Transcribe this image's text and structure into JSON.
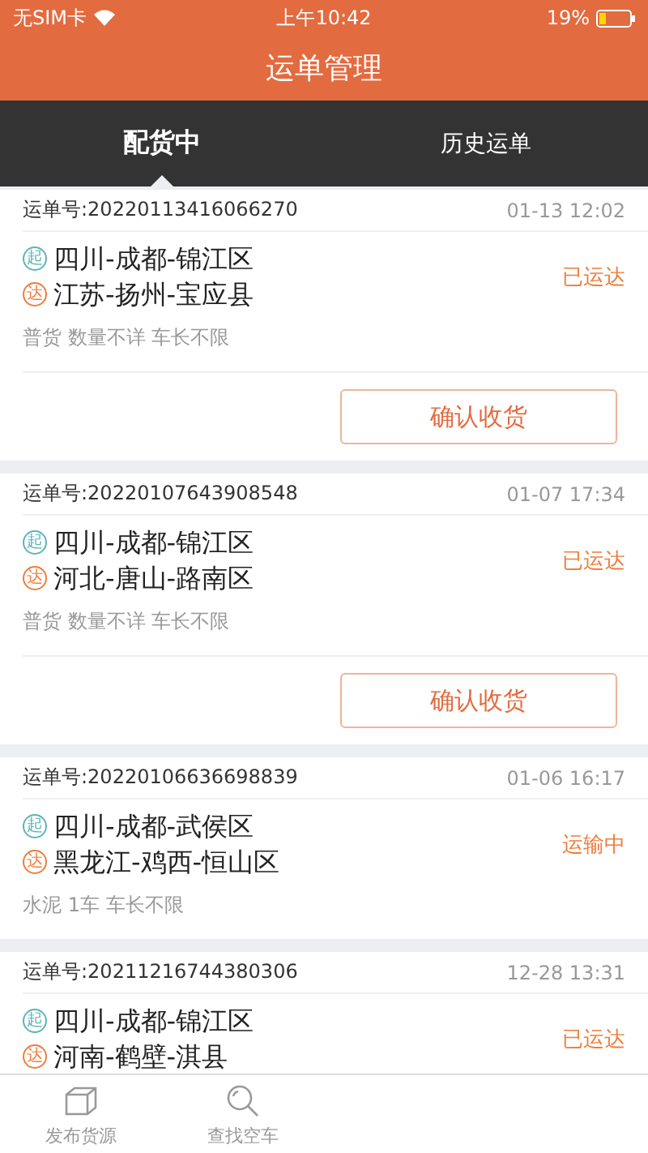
{
  "status_bar": {
    "carrier": "无SIM卡",
    "time": "上午10:42",
    "battery": "19%"
  },
  "header": {
    "title": "运单管理"
  },
  "tabs": [
    {
      "label": "配货中",
      "selected": true
    },
    {
      "label": "历史运单",
      "selected": false
    }
  ],
  "orders": [
    {
      "number": "运单号:20220113416066270",
      "time": "01-13 12:02",
      "from_mark": "起",
      "from": "四川-成都-锦江区",
      "to_mark": "达",
      "to": "江苏-扬州-宝应县",
      "status": "已运达",
      "details": "普货 数量不详 车长不限",
      "action": "确认收货"
    },
    {
      "number": "运单号:20220107643908548",
      "time": "01-07 17:34",
      "from_mark": "起",
      "from": "四川-成都-锦江区",
      "to_mark": "达",
      "to": "河北-唐山-路南区",
      "status": "已运达",
      "details": "普货 数量不详 车长不限",
      "action": "确认收货"
    },
    {
      "number": "运单号:20220106636698839",
      "time": "01-06 16:17",
      "from_mark": "起",
      "from": "四川-成都-武侯区",
      "to_mark": "达",
      "to": "黑龙江-鸡西-恒山区",
      "status": "运输中",
      "details": "水泥 1车 车长不限"
    },
    {
      "number": "运单号:20211216744380306",
      "time": "12-28 13:31",
      "from_mark": "起",
      "from": "四川-成都-锦江区",
      "to_mark": "达",
      "to": "河南-鹤壁-淇县",
      "status": "已运达"
    }
  ],
  "tab_bar": [
    {
      "label": "发布货源",
      "kind": "box",
      "selected": false
    },
    {
      "label": "查找空车",
      "kind": "search",
      "selected": false
    }
  ]
}
